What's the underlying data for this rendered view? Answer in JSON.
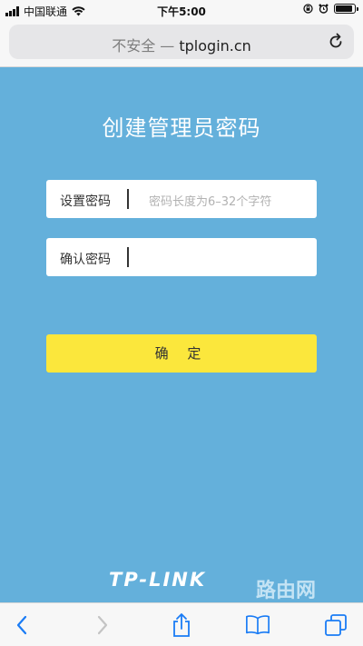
{
  "status_bar": {
    "carrier": "中国联通",
    "time": "下午5:00"
  },
  "browser": {
    "insecure_label": "不安全 —",
    "url": "tplogin.cn"
  },
  "page": {
    "title": "创建管理员密码",
    "password_field": {
      "label": "设置密码",
      "placeholder": "密码长度为6–32个字符"
    },
    "confirm_field": {
      "label": "确认密码"
    },
    "confirm_button": "确 定",
    "brand": "TP-LINK",
    "watermark": "路由网"
  },
  "toolbar": {
    "icons": [
      "back-icon",
      "forward-icon",
      "share-icon",
      "bookmarks-icon",
      "tabs-icon"
    ]
  },
  "colors": {
    "page_background": "#64b0db",
    "button": "#fbe73c"
  }
}
